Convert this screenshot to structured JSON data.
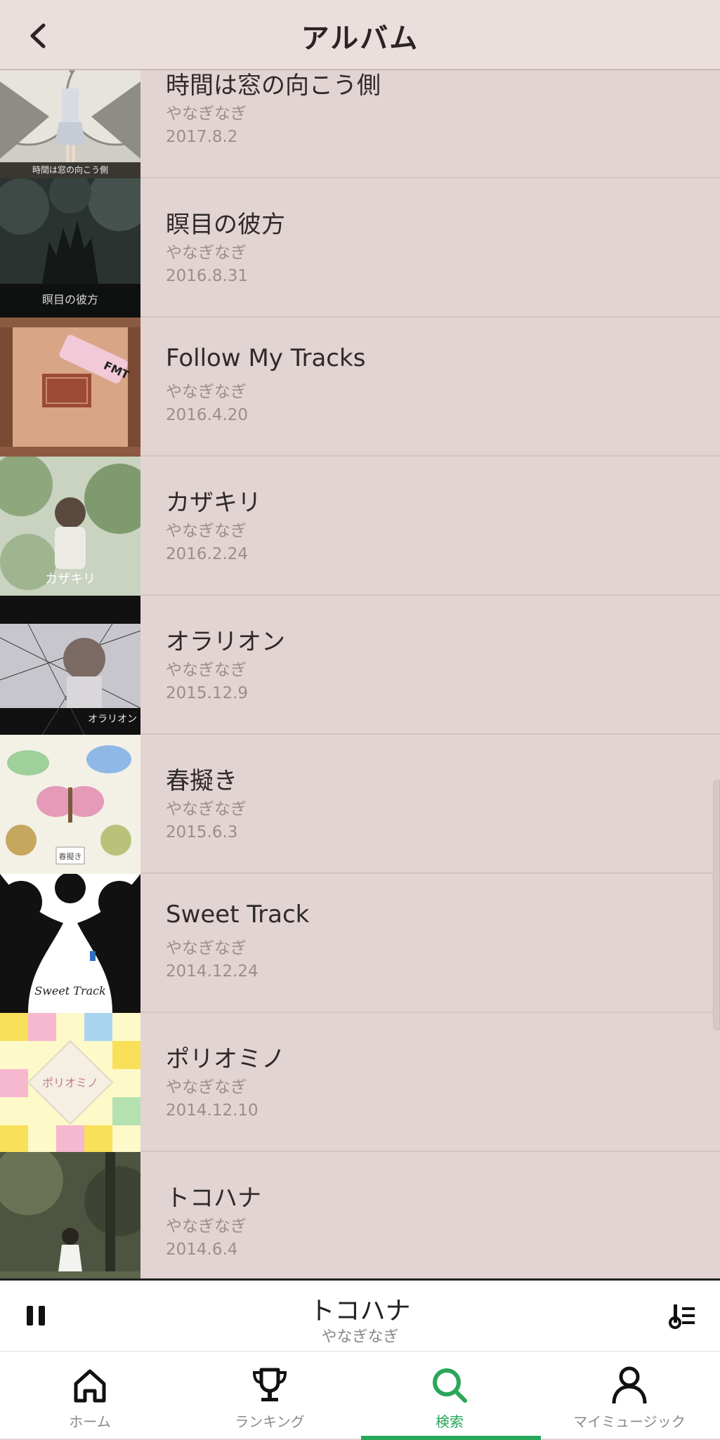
{
  "header": {
    "title": "アルバム"
  },
  "albums": [
    {
      "title": "時間は窓の向こう側",
      "artist": "やなぎなぎ",
      "date": "2017.8.2",
      "cover_text": "時間は窓の向こう側"
    },
    {
      "title": "瞑目の彼方",
      "artist": "やなぎなぎ",
      "date": "2016.8.31",
      "cover_text": "瞑目の彼方"
    },
    {
      "title": "Follow My Tracks",
      "artist": "やなぎなぎ",
      "date": "2016.4.20",
      "cover_text": "FMT"
    },
    {
      "title": "カザキリ",
      "artist": "やなぎなぎ",
      "date": "2016.2.24",
      "cover_text": "カザキリ"
    },
    {
      "title": "オラリオン",
      "artist": "やなぎなぎ",
      "date": "2015.12.9",
      "cover_text": "オラリオン"
    },
    {
      "title": "春擬き",
      "artist": "やなぎなぎ",
      "date": "2015.6.3",
      "cover_text": "春擬き"
    },
    {
      "title": "Sweet Track",
      "artist": "やなぎなぎ",
      "date": "2014.12.24",
      "cover_text": "Sweet Track"
    },
    {
      "title": "ポリオミノ",
      "artist": "やなぎなぎ",
      "date": "2014.12.10",
      "cover_text": "ポリオミノ"
    },
    {
      "title": "トコハナ",
      "artist": "やなぎなぎ",
      "date": "2014.6.4",
      "cover_text": ""
    }
  ],
  "now_playing": {
    "title": "トコハナ",
    "artist": "やなぎなぎ"
  },
  "nav": [
    {
      "label": "ホーム",
      "icon": "home-icon"
    },
    {
      "label": "ランキング",
      "icon": "trophy-icon"
    },
    {
      "label": "検索",
      "icon": "search-icon",
      "active": true
    },
    {
      "label": "マイミュージック",
      "icon": "person-icon"
    }
  ],
  "colors": {
    "accent": "#2aa65a",
    "background": "#e2d4d2",
    "header": "#ebdfdd"
  }
}
